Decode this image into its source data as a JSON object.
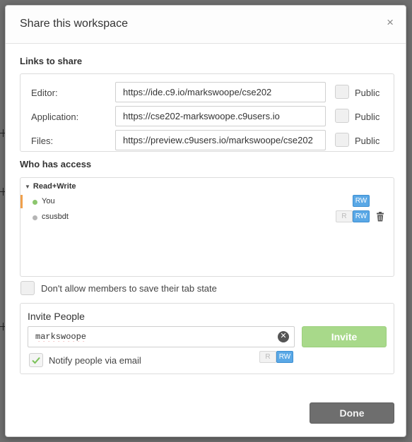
{
  "dialog": {
    "title": "Share this workspace",
    "close_glyph": "×"
  },
  "links": {
    "section_title": "Links to share",
    "rows": [
      {
        "label": "Editor:",
        "url": "https://ide.c9.io/markswoope/cse202",
        "public_label": "Public",
        "public_checked": false
      },
      {
        "label": "Application:",
        "url": "https://cse202-markswoope.c9users.io",
        "public_label": "Public",
        "public_checked": false
      },
      {
        "label": "Files:",
        "url": "https://preview.c9users.io/markswoope/cse202",
        "public_label": "Public",
        "public_checked": false
      }
    ]
  },
  "access": {
    "section_title": "Who has access",
    "group_label": "Read+Write",
    "members": [
      {
        "name": "You",
        "status_color": "#8cc66d",
        "perm_rw": "RW"
      },
      {
        "name": "csusbdt",
        "status_color": "#b5b5b5",
        "perm_r": "R",
        "perm_rw": "RW"
      }
    ]
  },
  "tab_state": {
    "label": "Don't allow members to save their tab state",
    "checked": false
  },
  "invite": {
    "title": "Invite People",
    "input_value": "markswoope",
    "button_label": "Invite",
    "notify_label": "Notify people via email",
    "notify_checked": true,
    "perm_r": "R",
    "perm_rw": "RW"
  },
  "footer": {
    "done_label": "Done"
  },
  "colors": {
    "accent_blue": "#5aa8e6",
    "invite_green": "#a8d98a",
    "owner_marker": "#f0a04b",
    "done_gray": "#6e6e6e"
  },
  "icons": {
    "close": "close-icon",
    "collapse": "triangle-down-icon",
    "delete": "trash-icon",
    "clear": "clear-input-icon",
    "check": "checkmark-icon"
  }
}
